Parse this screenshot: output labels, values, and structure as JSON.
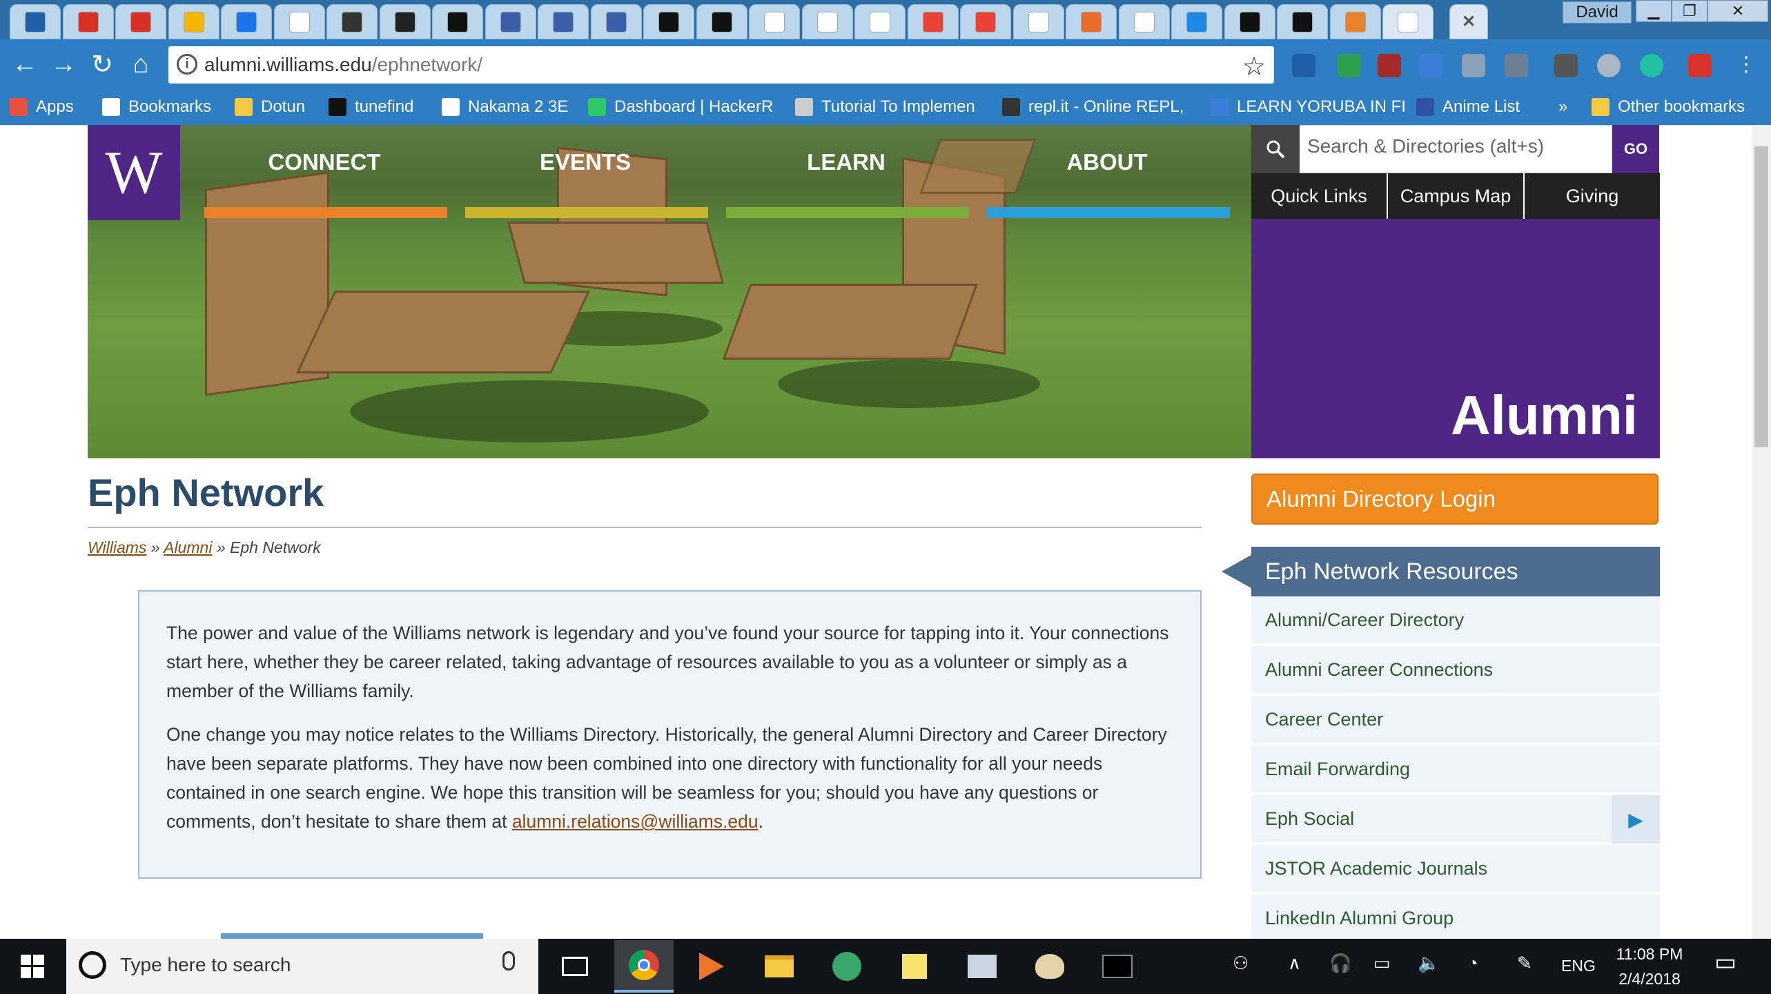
{
  "browser": {
    "user_name": "David",
    "tab_count_visible": 27,
    "url_host": "alumni.williams.edu",
    "url_path": "/ephnetwork/",
    "bookmarks": [
      {
        "label": "Apps",
        "icon": "apps-grid-icon"
      },
      {
        "label": "Bookmarks",
        "icon": "star-icon"
      },
      {
        "label": "Dotun",
        "icon": "folder-icon"
      },
      {
        "label": "tunefind",
        "icon": "tunefind-icon"
      },
      {
        "label": "Nakama 2 3E",
        "icon": "page-icon"
      },
      {
        "label": "Dashboard | HackerR",
        "icon": "hackerrank-icon"
      },
      {
        "label": "Tutorial To Implemen",
        "icon": "tutorial-icon"
      },
      {
        "label": "repl.it - Online REPL,",
        "icon": "replit-icon"
      },
      {
        "label": "LEARN YORUBA IN FI",
        "icon": "page-icon"
      },
      {
        "label": "Anime List",
        "icon": "mal-icon"
      }
    ],
    "bookmarks_overflow": "»",
    "other_bookmarks": "Other bookmarks"
  },
  "site": {
    "logo_letter": "W",
    "nav": [
      {
        "label": "CONNECT",
        "color": "#e8822a"
      },
      {
        "label": "EVENTS",
        "color": "#c9b62e"
      },
      {
        "label": "LEARN",
        "color": "#7aac3a"
      },
      {
        "label": "ABOUT",
        "color": "#2b9fd8"
      }
    ],
    "search_placeholder": "Search & Directories (alt+s)",
    "search_go": "GO",
    "quick_links": [
      "Quick Links",
      "Campus Map",
      "Giving"
    ],
    "section_title": "Alumni",
    "page_title": "Eph Network",
    "breadcrumb": {
      "home": "Williams",
      "parent": "Alumni",
      "sep": "»",
      "current": "Eph Network"
    },
    "intro_p1": "The power and value of the Williams network is legendary and you’ve found your source for tapping into it. Your connections start here, whether they be career related, taking advantage of resources available to you as a volunteer or simply as a member of the Williams family.",
    "intro_p2": "One change you may notice relates to the Williams Directory. Historically, the general Alumni Directory and Career Directory have been separate platforms. They have now been combined into one directory with functionality for all your needs contained in one search engine. We hope this transition will be seamless for you; should you have any questions or comments, don’t hesitate to share them at ",
    "intro_email": "alumni.relations@williams.edu",
    "intro_end": ".",
    "login_button": "Alumni Directory Login",
    "resources_title": "Eph Network Resources",
    "resources": [
      "Alumni/Career Directory",
      "Alumni Career Connections",
      "Career Center",
      "Email Forwarding",
      "Eph Social",
      "JSTOR Academic Journals",
      "LinkedIn Alumni Group"
    ]
  },
  "taskbar": {
    "search_placeholder": "Type here to search",
    "language": "ENG",
    "time": "11:08 PM",
    "date": "2/4/2018"
  },
  "colors": {
    "williams_purple": "#4f2683",
    "login_orange": "#f08a1c",
    "resources_header": "#4b6b8f",
    "title_blue": "#2c4a6a"
  }
}
